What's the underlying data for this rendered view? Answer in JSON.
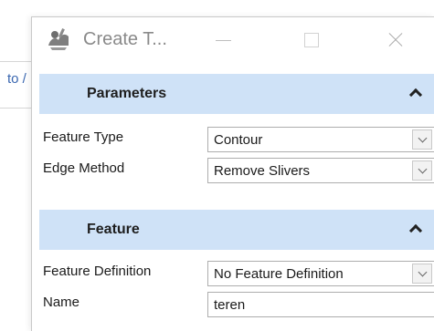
{
  "background": {
    "partial_text": "to /"
  },
  "window": {
    "title": "Create T...",
    "icon": "terrain-tools-icon",
    "controls": {
      "minimize_icon": "minimize-icon",
      "maximize_icon": "maximize-icon",
      "close_icon": "close-icon"
    }
  },
  "sections": {
    "parameters": {
      "title": "Parameters",
      "fields": {
        "feature_type": {
          "label": "Feature Type",
          "value": "Contour"
        },
        "edge_method": {
          "label": "Edge Method",
          "value": "Remove Slivers"
        }
      }
    },
    "feature": {
      "title": "Feature",
      "fields": {
        "feature_definition": {
          "label": "Feature Definition",
          "value": "No Feature Definition"
        },
        "name": {
          "label": "Name",
          "value": "teren"
        }
      }
    }
  },
  "colors": {
    "section_header_bg": "#cfe2f7",
    "link_blue": "#3a67b0",
    "title_gray": "#8a8a8a"
  }
}
